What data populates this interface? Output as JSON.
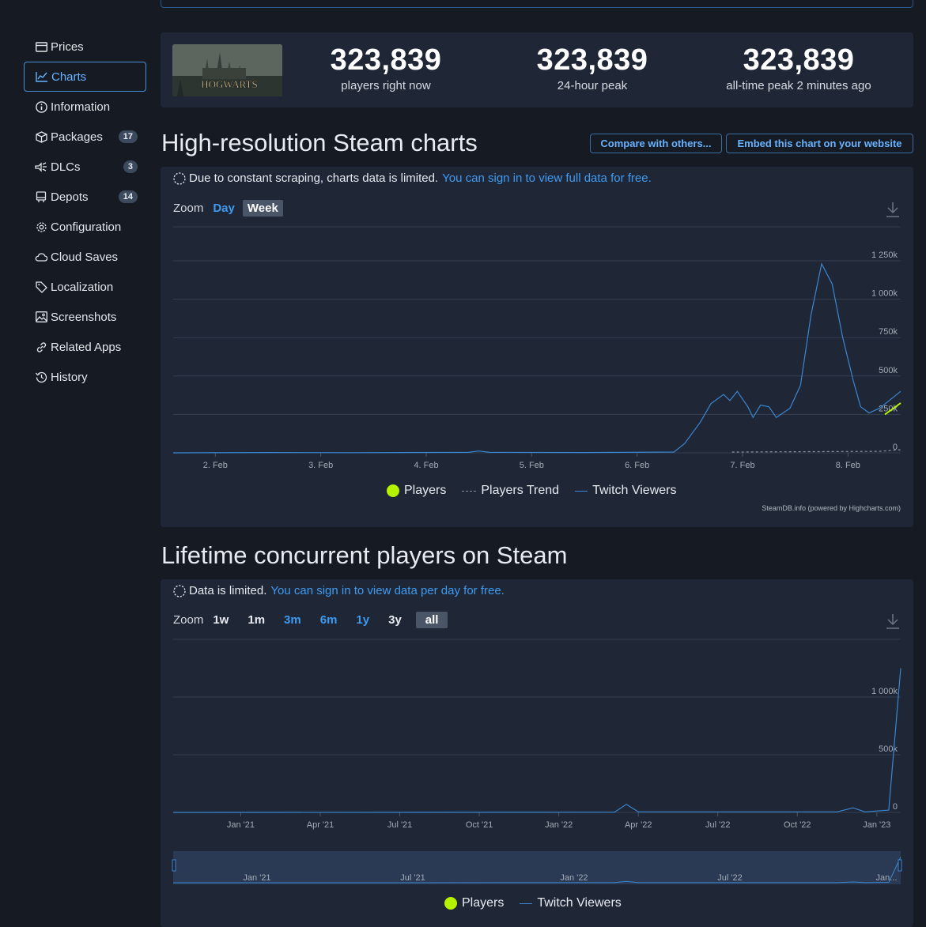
{
  "sidebar": {
    "items": [
      {
        "label": "Prices",
        "icon": "credit-card-icon"
      },
      {
        "label": "Charts",
        "icon": "line-chart-icon",
        "active": true
      },
      {
        "label": "Information",
        "icon": "info-icon"
      },
      {
        "label": "Packages",
        "icon": "package-icon",
        "badge": "17"
      },
      {
        "label": "DLCs",
        "icon": "dlc-icon",
        "badge": "3"
      },
      {
        "label": "Depots",
        "icon": "depot-icon",
        "badge": "14"
      },
      {
        "label": "Configuration",
        "icon": "gear-icon"
      },
      {
        "label": "Cloud Saves",
        "icon": "cloud-icon"
      },
      {
        "label": "Localization",
        "icon": "tag-icon"
      },
      {
        "label": "Screenshots",
        "icon": "image-icon"
      },
      {
        "label": "Related Apps",
        "icon": "link-icon"
      },
      {
        "label": "History",
        "icon": "history-icon"
      }
    ]
  },
  "stats": {
    "game_image_text": "HOGWARTS",
    "players_now": {
      "value": "323,839",
      "label": "players right now"
    },
    "peak_24h": {
      "value": "323,839",
      "label": "24-hour peak"
    },
    "peak_all": {
      "value": "323,839",
      "label": "all-time peak 2 minutes ago"
    }
  },
  "hires": {
    "title": "High-resolution Steam charts",
    "compare_btn": "Compare with others...",
    "embed_btn": "Embed this chart on your website",
    "notice": "Due to constant scraping, charts data is limited.",
    "notice_link": "You can sign in to view full data for free.",
    "zoom_label": "Zoom",
    "zoom_options": [
      "Day",
      "Week"
    ],
    "legend": {
      "players": "Players",
      "trend": "Players Trend",
      "twitch": "Twitch Viewers"
    },
    "credit": "SteamDB.info (powered by Highcharts.com)"
  },
  "lifetime": {
    "title": "Lifetime concurrent players on Steam",
    "notice": "Data is limited.",
    "notice_link": "You can sign in to view data per day for free.",
    "zoom_label": "Zoom",
    "zoom_options": [
      "1w",
      "1m",
      "3m",
      "6m",
      "1y",
      "3y",
      "all"
    ],
    "legend": {
      "players": "Players",
      "twitch": "Twitch Viewers"
    }
  },
  "chart_data": [
    {
      "type": "line",
      "ylim": [
        0,
        1250000
      ],
      "yticks": [
        {
          "v": 1250000,
          "l": "1 250k"
        },
        {
          "v": 1000000,
          "l": "1 000k"
        },
        {
          "v": 750000,
          "l": "750k"
        },
        {
          "v": 500000,
          "l": "500k"
        },
        {
          "v": 250000,
          "l": "250k"
        },
        {
          "v": 0,
          "l": "0"
        }
      ],
      "xlim": [
        1.6,
        8.5
      ],
      "xticks": [
        {
          "v": 2,
          "l": "2. Feb"
        },
        {
          "v": 3,
          "l": "3. Feb"
        },
        {
          "v": 4,
          "l": "4. Feb"
        },
        {
          "v": 5,
          "l": "5. Feb"
        },
        {
          "v": 6,
          "l": "6. Feb"
        },
        {
          "v": 7,
          "l": "7. Feb"
        },
        {
          "v": 8,
          "l": "8. Feb"
        }
      ],
      "series": [
        {
          "name": "Twitch Viewers",
          "color": "#3a86d0",
          "points": [
            [
              1.6,
              0
            ],
            [
              2.5,
              2000
            ],
            [
              3.3,
              1000
            ],
            [
              4.4,
              3000
            ],
            [
              4.5,
              12000
            ],
            [
              4.6,
              3000
            ],
            [
              5.5,
              2000
            ],
            [
              6.35,
              5000
            ],
            [
              6.45,
              60000
            ],
            [
              6.6,
              200000
            ],
            [
              6.7,
              320000
            ],
            [
              6.82,
              380000
            ],
            [
              6.88,
              340000
            ],
            [
              6.95,
              400000
            ],
            [
              7.05,
              300000
            ],
            [
              7.1,
              230000
            ],
            [
              7.17,
              310000
            ],
            [
              7.25,
              300000
            ],
            [
              7.32,
              230000
            ],
            [
              7.45,
              290000
            ],
            [
              7.55,
              440000
            ],
            [
              7.65,
              900000
            ],
            [
              7.75,
              1230000
            ],
            [
              7.85,
              1100000
            ],
            [
              7.95,
              750000
            ],
            [
              8.05,
              470000
            ],
            [
              8.12,
              300000
            ],
            [
              8.2,
              260000
            ],
            [
              8.3,
              290000
            ],
            [
              8.5,
              400000
            ]
          ]
        },
        {
          "name": "Players",
          "color": "#b5f200",
          "points": [
            [
              8.35,
              250000
            ],
            [
              8.5,
              323839
            ]
          ]
        },
        {
          "name": "Players Trend",
          "color": "#8a929e",
          "dashed": true,
          "points": [
            [
              6.9,
              5000
            ],
            [
              8.3,
              10000
            ],
            [
              8.5,
              20000
            ]
          ]
        }
      ]
    },
    {
      "type": "line",
      "ylim": [
        0,
        1000000
      ],
      "yticks": [
        {
          "v": 1000000,
          "l": "1 000k"
        },
        {
          "v": 500000,
          "l": "500k"
        },
        {
          "v": 0,
          "l": "0"
        }
      ],
      "xlim": [
        -0.85,
        8.3
      ],
      "xticks": [
        {
          "v": 0,
          "l": "Jan '21"
        },
        {
          "v": 1,
          "l": "Apr '21"
        },
        {
          "v": 2,
          "l": "Jul '21"
        },
        {
          "v": 3,
          "l": "Oct '21"
        },
        {
          "v": 4,
          "l": "Jan '22"
        },
        {
          "v": 5,
          "l": "Apr '22"
        },
        {
          "v": 6,
          "l": "Jul '22"
        },
        {
          "v": 7,
          "l": "Oct '22"
        },
        {
          "v": 8,
          "l": "Jan '23"
        }
      ],
      "navigator_labels": [
        "Jan '21",
        "Jul '21",
        "Jan '22",
        "Jul '22",
        "Jan..."
      ],
      "series": [
        {
          "name": "Twitch Viewers",
          "color": "#3a86d0",
          "points": [
            [
              -0.85,
              0
            ],
            [
              4.7,
              2000
            ],
            [
              4.85,
              70000
            ],
            [
              5.0,
              5000
            ],
            [
              7.5,
              5000
            ],
            [
              7.7,
              40000
            ],
            [
              7.85,
              5000
            ],
            [
              8.15,
              20000
            ],
            [
              8.3,
              1250000
            ]
          ]
        },
        {
          "name": "Players",
          "color": "#b5f200",
          "points": []
        }
      ]
    }
  ]
}
